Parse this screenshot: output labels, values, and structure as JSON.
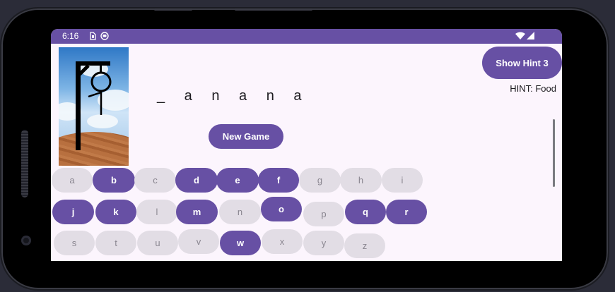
{
  "status_bar": {
    "time": "6:16"
  },
  "game": {
    "masked_word": "_ a n a n a",
    "new_game_label": "New Game",
    "show_hint_label": "Show Hint 3",
    "hint_text": "HINT: Food"
  },
  "keys": [
    {
      "letter": "a",
      "used": false
    },
    {
      "letter": "b",
      "used": true
    },
    {
      "letter": "c",
      "used": false
    },
    {
      "letter": "d",
      "used": true
    },
    {
      "letter": "e",
      "used": true
    },
    {
      "letter": "f",
      "used": true
    },
    {
      "letter": "g",
      "used": false
    },
    {
      "letter": "h",
      "used": false
    },
    {
      "letter": "i",
      "used": false
    },
    {
      "letter": "j",
      "used": true
    },
    {
      "letter": "k",
      "used": true
    },
    {
      "letter": "l",
      "used": false
    },
    {
      "letter": "m",
      "used": true
    },
    {
      "letter": "n",
      "used": false
    },
    {
      "letter": "o",
      "used": true
    },
    {
      "letter": "p",
      "used": false
    },
    {
      "letter": "q",
      "used": true
    },
    {
      "letter": "r",
      "used": true
    },
    {
      "letter": "s",
      "used": false
    },
    {
      "letter": "t",
      "used": false
    },
    {
      "letter": "u",
      "used": false
    },
    {
      "letter": "v",
      "used": false
    },
    {
      "letter": "w",
      "used": true
    },
    {
      "letter": "x",
      "used": false
    },
    {
      "letter": "y",
      "used": false
    },
    {
      "letter": "z",
      "used": false
    }
  ],
  "colors": {
    "accent": "#6750a4",
    "key_available": "#e2dde5",
    "background": "#fcf5fd"
  },
  "icons": [
    "sim-icon",
    "shield-icon",
    "wifi-icon",
    "signal-icon",
    "hangman-image"
  ]
}
